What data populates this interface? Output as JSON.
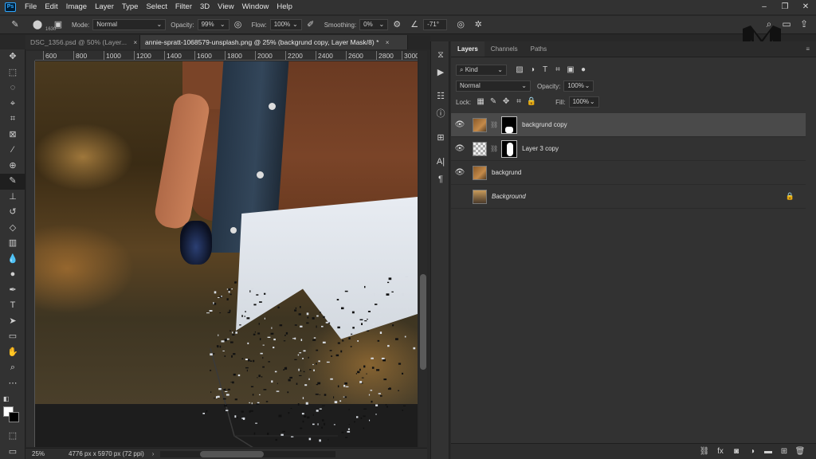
{
  "menu": [
    "File",
    "Edit",
    "Image",
    "Layer",
    "Type",
    "Select",
    "Filter",
    "3D",
    "View",
    "Window",
    "Help"
  ],
  "app_logo": "Ps",
  "window_controls": [
    "–",
    "❐",
    "✕"
  ],
  "options": {
    "brush_size": "1630",
    "mode_label": "Mode:",
    "mode_value": "Normal",
    "opacity_label": "Opacity:",
    "opacity_value": "99%",
    "flow_label": "Flow:",
    "flow_value": "100%",
    "smoothing_label": "Smoothing:",
    "smoothing_value": "0%",
    "angle_value": "-71°"
  },
  "doc_tabs": [
    {
      "label": "DSC_1356.psd @ 50% (Layer...",
      "close": "×"
    },
    {
      "label": "annie-spratt-1068579-unsplash.png @ 25% (backgrund copy, Layer Mask/8) *",
      "close": "×"
    }
  ],
  "ruler": [
    "600",
    "800",
    "1000",
    "1200",
    "1400",
    "1600",
    "1800",
    "2000",
    "2200",
    "2400",
    "2600",
    "2800",
    "3000"
  ],
  "status": {
    "zoom": "25%",
    "doc_size": "4776 px x 5970 px (72 ppi)",
    "arrow": "›"
  },
  "panel": {
    "tabs": [
      "Layers",
      "Channels",
      "Paths"
    ],
    "filter_kind": "Kind",
    "blend_mode": "Normal",
    "opacity_label": "Opacity:",
    "opacity_value": "100%",
    "lock_label": "Lock:",
    "fill_label": "Fill:",
    "fill_value": "100%"
  },
  "layers": [
    {
      "name": "backgrund copy",
      "visible": true,
      "selected": true,
      "has_mask": true,
      "italic": false,
      "locked": false
    },
    {
      "name": "Layer 3 copy",
      "visible": true,
      "selected": false,
      "has_mask": true,
      "italic": false,
      "locked": false
    },
    {
      "name": "backgrund",
      "visible": true,
      "selected": false,
      "has_mask": false,
      "italic": false,
      "locked": false
    },
    {
      "name": "Background",
      "visible": false,
      "selected": false,
      "has_mask": false,
      "italic": true,
      "locked": true
    }
  ],
  "colors": {
    "foreground": "#ffffff",
    "background": "#000000",
    "accent": "#31a8ff"
  }
}
